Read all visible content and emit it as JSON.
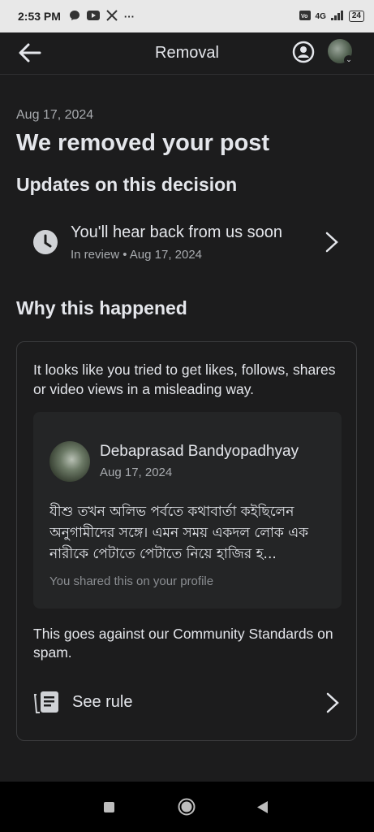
{
  "status_bar": {
    "time": "2:53 PM",
    "icons": [
      "messenger-icon",
      "youtube-icon",
      "x-icon",
      "more-icon"
    ],
    "more": "···",
    "network": "4G",
    "battery": "24"
  },
  "header": {
    "title": "Removal"
  },
  "decision": {
    "date": "Aug 17, 2024",
    "headline": "We removed your post",
    "updates_heading": "Updates on this decision"
  },
  "update": {
    "title": "You'll hear back from us soon",
    "meta": "In review • Aug 17, 2024"
  },
  "why": {
    "heading": "Why this happened",
    "reason": "It looks like you tried to get likes, follows, shares or video views in a misleading way."
  },
  "post": {
    "author": "Debaprasad Bandyopadhyay",
    "date": "Aug 17, 2024",
    "text": "যীশু তখন অলিভ পর্বতে কথাবার্তা কইছিলেন অনুগামীদের সঙ্গে। এমন সময় একদল লোক এক নারীকে পেটাতে পেটাতে নিয়ে হাজির হ...",
    "footer": "You shared this on your profile"
  },
  "standards": {
    "text": "This goes against our Community Standards on spam.",
    "see_rule": "See rule"
  },
  "colors": {
    "background": "#1c1c1d",
    "card_background": "#242526",
    "text_primary": "#e4e6eb",
    "text_secondary": "#a8abaf"
  }
}
